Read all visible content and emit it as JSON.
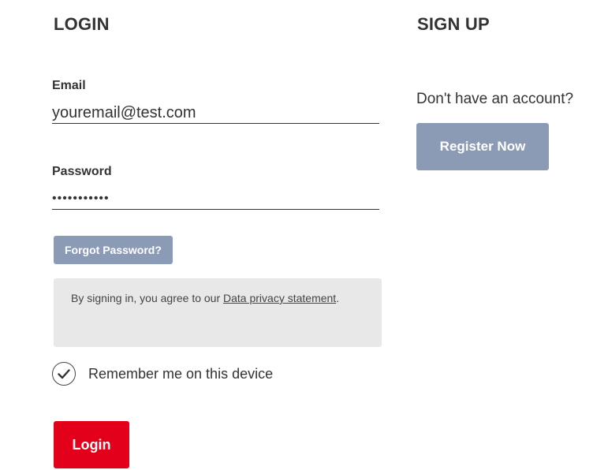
{
  "login": {
    "title": "LOGIN",
    "email": {
      "label": "Email",
      "value": "youremail@test.com"
    },
    "password": {
      "label": "Password",
      "value": "•••••••••••"
    },
    "forgot_label": "Forgot Password?",
    "notice": {
      "prefix": "By signing in, you agree to our ",
      "link": "Data privacy statement",
      "suffix": "."
    },
    "remember": {
      "label": "Remember me on this device",
      "checked": true
    },
    "submit_label": "Login"
  },
  "signup": {
    "title": "SIGN UP",
    "prompt": "Don't have an account?",
    "register_label": "Register Now"
  },
  "colors": {
    "accent_red": "#e2001a",
    "secondary_button": "#8b9bb6",
    "notice_background": "#e8e8e8",
    "text": "#333333"
  },
  "icons": {
    "remember_check": "checkmark-icon"
  }
}
